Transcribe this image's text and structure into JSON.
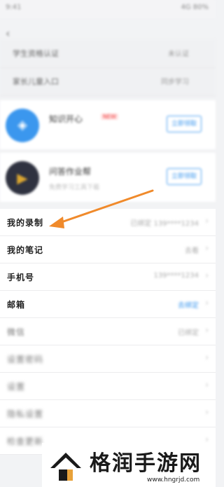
{
  "status": {
    "time": "9:41",
    "right": "4G 80%"
  },
  "header": {
    "back_icon": "chevron-left-icon"
  },
  "top_rows": [
    {
      "label": "学生资格认证",
      "value": "未认证"
    },
    {
      "label": "家长儿童入口",
      "value": "同步学习"
    }
  ],
  "apps": [
    {
      "title": "知识开心",
      "badge": "NEW",
      "desc": "",
      "button": "立即领取",
      "icon": "shield-icon",
      "color": "#3b97ee"
    },
    {
      "title": "问答作业帮",
      "badge": "",
      "desc": "免费学习工具下载",
      "button": "立即领取",
      "icon": "play-icon",
      "color": "#2f3240"
    }
  ],
  "list_rows": [
    {
      "label": "我的录制",
      "value": "已绑定 139****1234",
      "value_style": "muted"
    },
    {
      "label": "我的笔记",
      "value": "去看",
      "value_style": "muted"
    },
    {
      "label": "手机号",
      "value": "139****1234",
      "value_style": "muted"
    },
    {
      "label": "邮箱",
      "value": "去绑定",
      "value_style": "link"
    },
    {
      "label": "微信",
      "value": "已绑定",
      "value_style": "muted"
    },
    {
      "label": "设置密码",
      "value": "",
      "value_style": "muted"
    },
    {
      "label": "设置",
      "value": "",
      "value_style": "muted"
    },
    {
      "label": "隐私设置",
      "value": "",
      "value_style": "muted"
    },
    {
      "label": "检查更新",
      "value": "",
      "value_style": "muted"
    }
  ],
  "annotation": {
    "color": "#f08a2b",
    "target": "我的录制"
  },
  "watermark": {
    "title": "格润手游网",
    "url": "www.hngrjd.com"
  }
}
